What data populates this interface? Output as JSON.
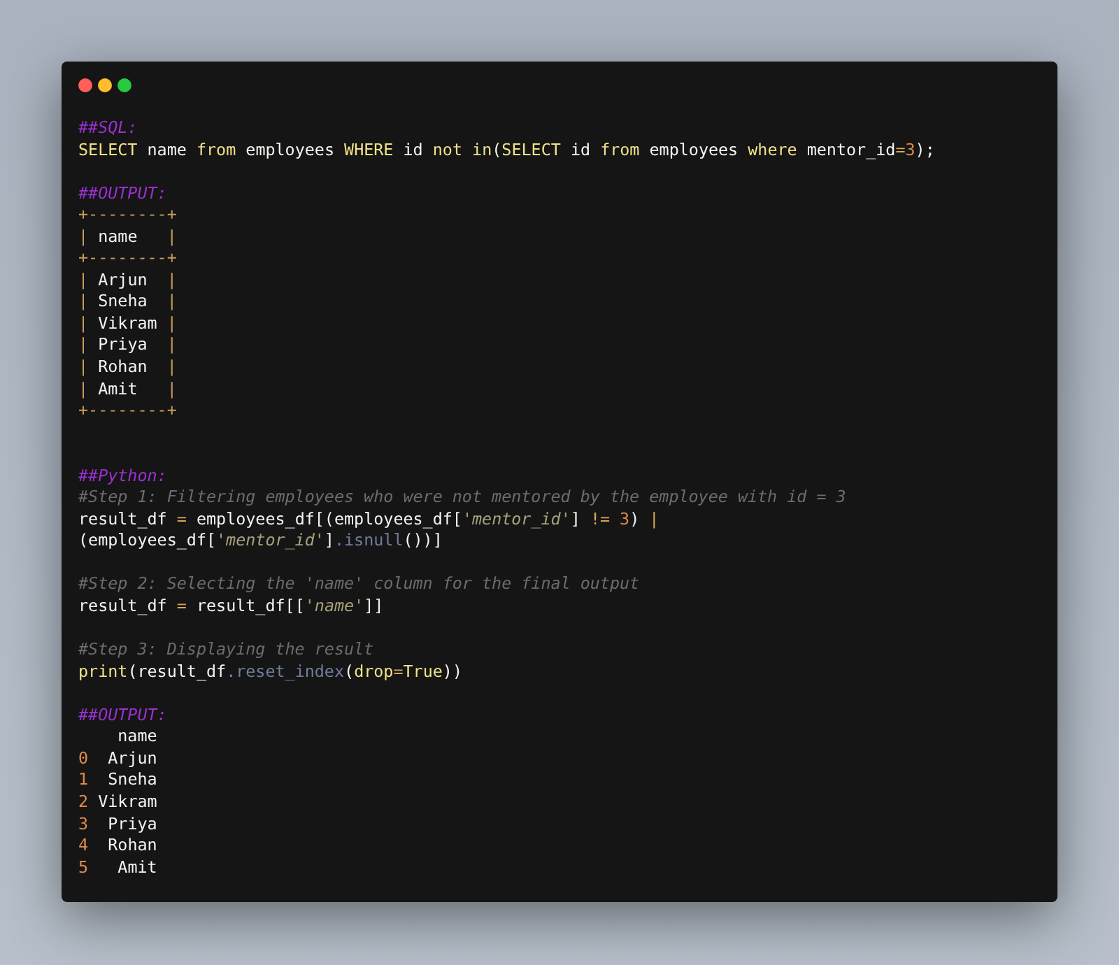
{
  "window": {
    "controls": [
      {
        "kind": "close"
      },
      {
        "kind": "minimize"
      },
      {
        "kind": "zoom"
      }
    ]
  },
  "blocks": [
    {
      "lines": [
        [
          {
            "kind": "heading",
            "text": "##SQL:"
          }
        ],
        [
          {
            "kind": "keyword",
            "text": "SELECT"
          },
          {
            "kind": "plain",
            "text": " name "
          },
          {
            "kind": "keyword",
            "text": "from"
          },
          {
            "kind": "plain",
            "text": " employees "
          },
          {
            "kind": "keyword",
            "text": "WHERE"
          },
          {
            "kind": "plain",
            "text": " id "
          },
          {
            "kind": "keyword",
            "text": "not"
          },
          {
            "kind": "keyword",
            "text": " in"
          },
          {
            "kind": "plain",
            "text": "("
          },
          {
            "kind": "keyword",
            "text": "SELECT"
          },
          {
            "kind": "plain",
            "text": " id "
          },
          {
            "kind": "keyword",
            "text": "from"
          },
          {
            "kind": "plain",
            "text": " employees "
          },
          {
            "kind": "keyword",
            "text": "where"
          },
          {
            "kind": "plain",
            "text": " mentor_id"
          },
          {
            "kind": "operator",
            "text": "="
          },
          {
            "kind": "number",
            "text": "3"
          },
          {
            "kind": "plain",
            "text": ");"
          }
        ]
      ]
    },
    {
      "lines": [
        [
          {
            "kind": "heading",
            "text": "##OUTPUT:"
          }
        ],
        [
          {
            "kind": "border",
            "text": "+--------+"
          }
        ],
        [
          {
            "kind": "border",
            "text": "|"
          },
          {
            "kind": "plain",
            "text": " name   "
          },
          {
            "kind": "border",
            "text": "|"
          }
        ],
        [
          {
            "kind": "border",
            "text": "+--------+"
          }
        ],
        [
          {
            "kind": "border",
            "text": "|"
          },
          {
            "kind": "plain",
            "text": " Arjun  "
          },
          {
            "kind": "border",
            "text": "|"
          }
        ],
        [
          {
            "kind": "border",
            "text": "|"
          },
          {
            "kind": "plain",
            "text": " Sneha  "
          },
          {
            "kind": "border",
            "text": "|"
          }
        ],
        [
          {
            "kind": "border",
            "text": "|"
          },
          {
            "kind": "plain",
            "text": " Vikram "
          },
          {
            "kind": "border",
            "text": "|"
          }
        ],
        [
          {
            "kind": "border",
            "text": "|"
          },
          {
            "kind": "plain",
            "text": " Priya  "
          },
          {
            "kind": "border",
            "text": "|"
          }
        ],
        [
          {
            "kind": "border",
            "text": "|"
          },
          {
            "kind": "plain",
            "text": " Rohan  "
          },
          {
            "kind": "border",
            "text": "|"
          }
        ],
        [
          {
            "kind": "border",
            "text": "|"
          },
          {
            "kind": "plain",
            "text": " Amit   "
          },
          {
            "kind": "border",
            "text": "|"
          }
        ],
        [
          {
            "kind": "border",
            "text": "+--------+"
          }
        ]
      ]
    },
    {
      "lines": [
        [
          {
            "kind": "heading",
            "text": "##Python:"
          }
        ],
        [
          {
            "kind": "comment",
            "text": "#Step 1: Filtering employees who were not mentored by the employee with id = 3"
          }
        ],
        [
          {
            "kind": "plain",
            "text": "result_df "
          },
          {
            "kind": "operator",
            "text": "="
          },
          {
            "kind": "plain",
            "text": " employees_df[(employees_df["
          },
          {
            "kind": "string",
            "text": "'mentor_id'"
          },
          {
            "kind": "plain",
            "text": "] "
          },
          {
            "kind": "operator",
            "text": "!="
          },
          {
            "kind": "number",
            "text": " 3"
          },
          {
            "kind": "plain",
            "text": ") "
          },
          {
            "kind": "operator",
            "text": "|"
          }
        ],
        [
          {
            "kind": "plain",
            "text": "(employees_df["
          },
          {
            "kind": "string",
            "text": "'mentor_id'"
          },
          {
            "kind": "plain",
            "text": "]"
          },
          {
            "kind": "method",
            "text": ".isnull"
          },
          {
            "kind": "plain",
            "text": "())]"
          }
        ]
      ]
    },
    {
      "lines": [
        [
          {
            "kind": "comment",
            "text": "#Step 2: Selecting the 'name' column for the final output"
          }
        ],
        [
          {
            "kind": "plain",
            "text": "result_df "
          },
          {
            "kind": "operator",
            "text": "="
          },
          {
            "kind": "plain",
            "text": " result_df[["
          },
          {
            "kind": "string",
            "text": "'name'"
          },
          {
            "kind": "plain",
            "text": "]]"
          }
        ]
      ]
    },
    {
      "lines": [
        [
          {
            "kind": "comment",
            "text": "#Step 3: Displaying the result"
          }
        ],
        [
          {
            "kind": "keyword",
            "text": "print"
          },
          {
            "kind": "plain",
            "text": "(result_df"
          },
          {
            "kind": "method",
            "text": ".reset_index"
          },
          {
            "kind": "plain",
            "text": "("
          },
          {
            "kind": "keyword",
            "text": "drop"
          },
          {
            "kind": "operator",
            "text": "="
          },
          {
            "kind": "keyword",
            "text": "True"
          },
          {
            "kind": "plain",
            "text": "))"
          }
        ]
      ]
    },
    {
      "lines": [
        [
          {
            "kind": "heading",
            "text": "##OUTPUT:"
          }
        ],
        [
          {
            "kind": "plain",
            "text": "    name"
          }
        ],
        [
          {
            "kind": "number",
            "text": "0"
          },
          {
            "kind": "plain",
            "text": "  Arjun"
          }
        ],
        [
          {
            "kind": "number",
            "text": "1"
          },
          {
            "kind": "plain",
            "text": "  Sneha"
          }
        ],
        [
          {
            "kind": "number",
            "text": "2"
          },
          {
            "kind": "plain",
            "text": " Vikram"
          }
        ],
        [
          {
            "kind": "number",
            "text": "3"
          },
          {
            "kind": "plain",
            "text": "  Priya"
          }
        ],
        [
          {
            "kind": "number",
            "text": "4"
          },
          {
            "kind": "plain",
            "text": "  Rohan"
          }
        ],
        [
          {
            "kind": "number",
            "text": "5"
          },
          {
            "kind": "plain",
            "text": "   Amit"
          }
        ]
      ]
    }
  ]
}
